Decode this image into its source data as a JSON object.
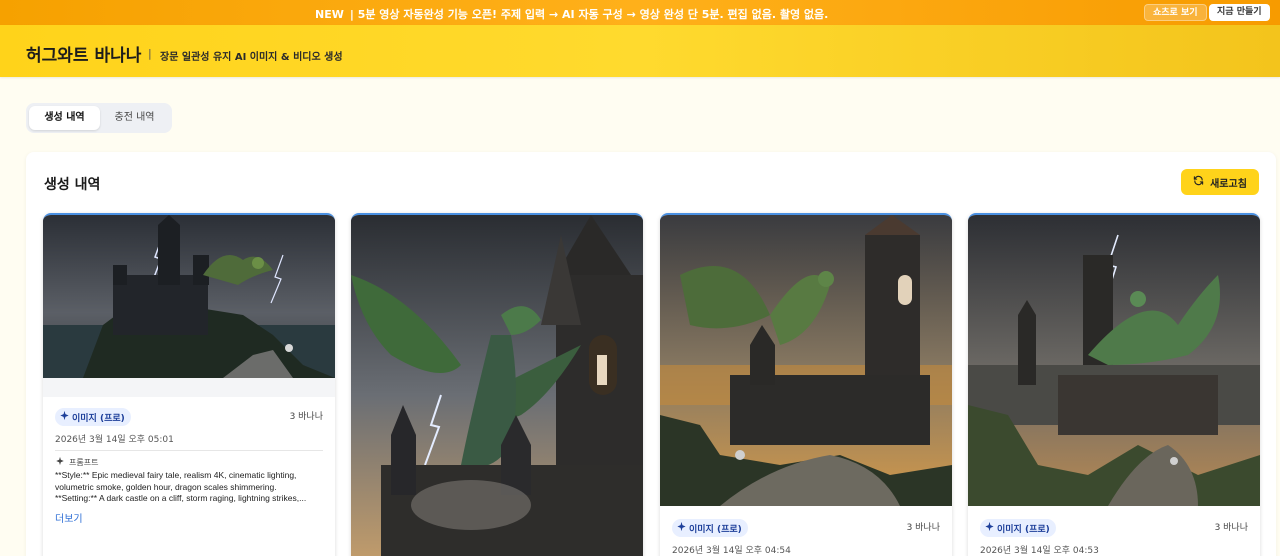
{
  "announce": {
    "new_label": "NEW",
    "message": "| 5분 영상 자동완성 기능 오픈! 주제 입력 → AI 자동 구성 → 영상 완성   단 5분. 편집 없음. 촬영 없음.",
    "shorts_button": "쇼츠로 보기",
    "make_button": "지금 만들기"
  },
  "header": {
    "brand": "허그와트 바나나",
    "divider": "|",
    "tagline": "장문 일관성 유지 AI 이미지 & 비디오 생성"
  },
  "tabs": [
    {
      "label": "생성 내역",
      "active": true
    },
    {
      "label": "충전 내역",
      "active": false
    }
  ],
  "panel": {
    "title": "생성 내역",
    "refresh_label": "새로고침"
  },
  "cards": [
    {
      "badge": "이미지 (프로)",
      "cost": "3 바나나",
      "date": "2026년 3월 14일 오후 05:01",
      "prompt_label": "프롬프트",
      "prompt_lines": [
        "**Style:** Epic medieval fairy tale, realism 4K, cinematic lighting,",
        "volumetric smoke, golden hour, dragon scales shimmering.",
        "**Setting:** A dark castle on a cliff, storm raging, lightning strikes,..."
      ],
      "more_label": "더보기"
    },
    {
      "badge": "",
      "cost": "",
      "date": ""
    },
    {
      "badge": "이미지 (프로)",
      "cost": "3 바나나",
      "date": "2026년 3월 14일 오후 04:54"
    },
    {
      "badge": "이미지 (프로)",
      "cost": "3 바나나",
      "date": "2026년 3월 14일 오후 04:53"
    }
  ],
  "colors": {
    "announce": "#f6a100",
    "header": "#ffd31a",
    "accent_blue": "#2f6fd6",
    "badge_bg": "#e8efff"
  },
  "icons": [
    "refresh-icon",
    "sparkle-icon",
    "castle-dragon-image"
  ]
}
